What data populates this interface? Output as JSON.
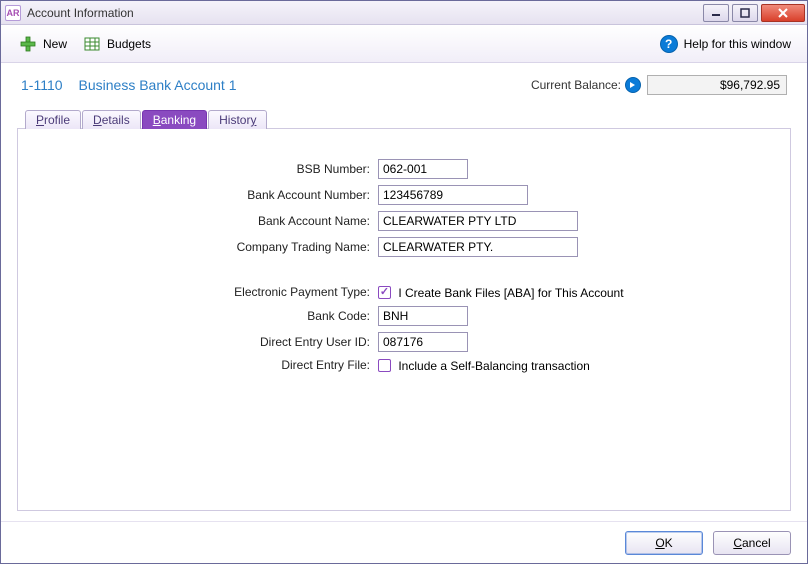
{
  "window": {
    "title": "Account Information",
    "icon_text": "AR"
  },
  "toolbar": {
    "new_label": "New",
    "budgets_label": "Budgets",
    "help_label": "Help for this window"
  },
  "header": {
    "account_number": "1-1110",
    "account_name": "Business Bank Account 1",
    "balance_label": "Current Balance:",
    "balance_value": "$96,792.95"
  },
  "tabs": {
    "profile": "Profile",
    "details": "Details",
    "banking": "Banking",
    "history": "History"
  },
  "form": {
    "bsb_label": "BSB Number:",
    "bsb_value": "062-001",
    "acct_num_label": "Bank Account Number:",
    "acct_num_value": "123456789",
    "acct_name_label": "Bank Account Name:",
    "acct_name_value": "CLEARWATER PTY LTD",
    "trading_label": "Company Trading Name:",
    "trading_value": "CLEARWATER PTY.",
    "epay_label": "Electronic Payment Type:",
    "epay_check_label": "I Create Bank Files [ABA] for This Account",
    "bankcode_label": "Bank Code:",
    "bankcode_value": "BNH",
    "deuser_label": "Direct Entry User ID:",
    "deuser_value": "087176",
    "defile_label": "Direct Entry File:",
    "defile_check_label": "Include a Self-Balancing transaction"
  },
  "footer": {
    "ok_label": "OK",
    "cancel_label": "Cancel"
  }
}
